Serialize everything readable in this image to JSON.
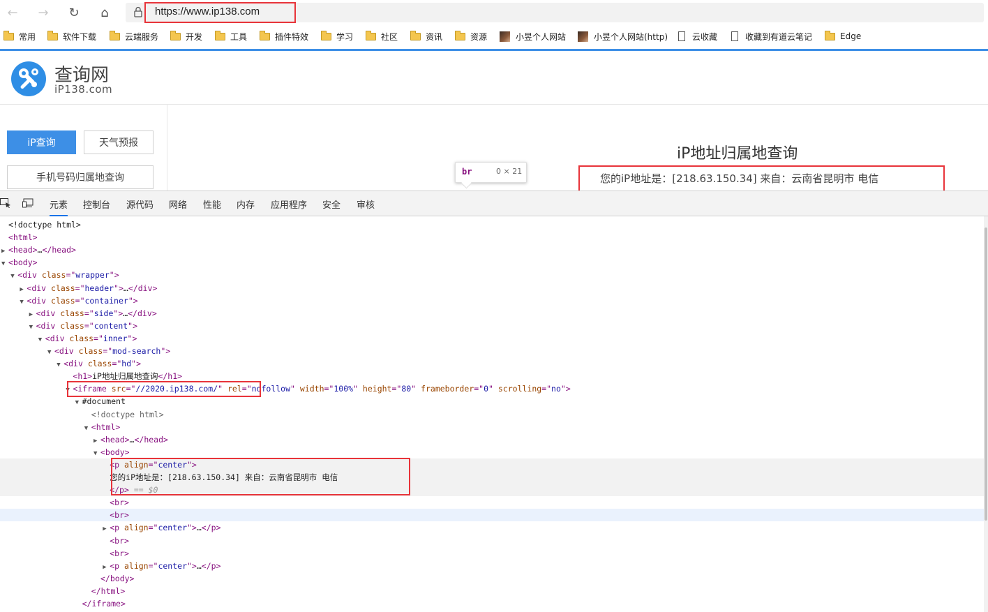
{
  "browser": {
    "url": "https://www.ip138.com",
    "bookmarks": [
      "常用",
      "软件下载",
      "云端服务",
      "开发",
      "工具",
      "插件特效",
      "学习",
      "社区",
      "资讯",
      "资源",
      "小昱个人网站",
      "小昱个人网站(http)",
      "云收藏",
      "收藏到有道云笔记",
      "Edge"
    ]
  },
  "site": {
    "logo_title": "查询网",
    "logo_sub": "iP138.com",
    "side": {
      "ip_btn": "iP查询",
      "weather_btn": "天气预报",
      "phone_btn": "手机号码归属地查询"
    },
    "h1": "iP地址归属地查询",
    "ip_line": "您的iP地址是：[218.63.150.34] 来自：云南省昆明市 电信"
  },
  "tooltip": {
    "tag": "br",
    "dims": "0 × 21"
  },
  "devtools": {
    "tabs": [
      "元素",
      "控制台",
      "源代码",
      "网络",
      "性能",
      "内存",
      "应用程序",
      "安全",
      "审核"
    ],
    "dom": [
      {
        "i": 0,
        "t": "",
        "h": "<span class='tx'>&lt;!doctype html&gt;</span>"
      },
      {
        "i": 0,
        "t": "",
        "h": "<span class='tg'>&lt;html&gt;</span>"
      },
      {
        "i": 0,
        "t": "▶",
        "h": "<span class='tg'>&lt;head&gt;</span><span class='tx'>…</span><span class='tg'>&lt;/head&gt;</span>"
      },
      {
        "i": 0,
        "t": "▼",
        "h": "<span class='tg'>&lt;body&gt;</span>"
      },
      {
        "i": 1,
        "t": "▼",
        "h": "<span class='tg'>&lt;div </span><span class='an'>class</span><span class='tg'>=\"</span><span class='av'>wrapper</span><span class='tg'>\"&gt;</span>"
      },
      {
        "i": 2,
        "t": "▶",
        "h": "<span class='tg'>&lt;div </span><span class='an'>class</span><span class='tg'>=\"</span><span class='av'>header</span><span class='tg'>\"&gt;</span><span class='tx'>…</span><span class='tg'>&lt;/div&gt;</span>"
      },
      {
        "i": 2,
        "t": "▼",
        "h": "<span class='tg'>&lt;div </span><span class='an'>class</span><span class='tg'>=\"</span><span class='av'>container</span><span class='tg'>\"&gt;</span>"
      },
      {
        "i": 3,
        "t": "▶",
        "h": "<span class='tg'>&lt;div </span><span class='an'>class</span><span class='tg'>=\"</span><span class='av'>side</span><span class='tg'>\"&gt;</span><span class='tx'>…</span><span class='tg'>&lt;/div&gt;</span>"
      },
      {
        "i": 3,
        "t": "▼",
        "h": "<span class='tg'>&lt;div </span><span class='an'>class</span><span class='tg'>=\"</span><span class='av'>content</span><span class='tg'>\"&gt;</span>"
      },
      {
        "i": 4,
        "t": "▼",
        "h": "<span class='tg'>&lt;div </span><span class='an'>class</span><span class='tg'>=\"</span><span class='av'>inner</span><span class='tg'>\"&gt;</span>"
      },
      {
        "i": 5,
        "t": "▼",
        "h": "<span class='tg'>&lt;div </span><span class='an'>class</span><span class='tg'>=\"</span><span class='av'>mod-search</span><span class='tg'>\"&gt;</span>"
      },
      {
        "i": 6,
        "t": "▼",
        "h": "<span class='tg'>&lt;div </span><span class='an'>class</span><span class='tg'>=\"</span><span class='av'>hd</span><span class='tg'>\"&gt;</span>"
      },
      {
        "i": 7,
        "t": "",
        "h": "<span class='tg'>&lt;h1&gt;</span><span class='tx'>iP地址归属地查询</span><span class='tg'>&lt;/h1&gt;</span>"
      },
      {
        "i": 7,
        "t": "▼",
        "h": "<span class='tg'>&lt;iframe </span><span class='an'>src</span><span class='tg'>=\"</span><span class='av'>//2020.ip138.com/</span><span class='tg'>\" </span><span class='an'>rel</span><span class='tg'>=\"</span><span class='av'>nofollow</span><span class='tg'>\" </span><span class='an'>width</span><span class='tg'>=\"</span><span class='av'>100%</span><span class='tg'>\" </span><span class='an'>height</span><span class='tg'>=\"</span><span class='av'>80</span><span class='tg'>\" </span><span class='an'>frameborder</span><span class='tg'>=\"</span><span class='av'>0</span><span class='tg'>\" </span><span class='an'>scrolling</span><span class='tg'>=\"</span><span class='av'>no</span><span class='tg'>\"&gt;</span>"
      },
      {
        "i": 8,
        "t": "▼",
        "h": "<span class='tx'>#document</span>"
      },
      {
        "i": 9,
        "t": "",
        "h": "<span class='tx' style='color:#666'>&lt;!doctype html&gt;</span>"
      },
      {
        "i": 9,
        "t": "▼",
        "h": "<span class='tg'>&lt;html&gt;</span>"
      },
      {
        "i": 10,
        "t": "▶",
        "h": "<span class='tg'>&lt;head&gt;</span><span class='tx'>…</span><span class='tg'>&lt;/head&gt;</span>"
      },
      {
        "i": 10,
        "t": "▼",
        "h": "<span class='tg'>&lt;body&gt;</span>"
      },
      {
        "i": 11,
        "t": "",
        "h": "<span class='tg'>&lt;p </span><span class='an'>align</span><span class='tg'>=\"</span><span class='av'>center</span><span class='tg'>\"&gt;</span>",
        "sel": true
      },
      {
        "i": 11,
        "t": "",
        "h": "<span class='tx'>您的iP地址是：[218.63.150.34] 来自：云南省昆明市 电信</span>",
        "sel": true
      },
      {
        "i": 11,
        "t": "",
        "h": "<span class='tg'>&lt;/p&gt;</span><span class='cm'> == $0</span>",
        "sel": true
      },
      {
        "i": 11,
        "t": "",
        "h": "<span class='tg'>&lt;br&gt;</span>"
      },
      {
        "i": 11,
        "t": "",
        "h": "<span class='tg'>&lt;br&gt;</span>",
        "hover": true
      },
      {
        "i": 11,
        "t": "▶",
        "h": "<span class='tg'>&lt;p </span><span class='an'>align</span><span class='tg'>=\"</span><span class='av'>center</span><span class='tg'>\"&gt;</span><span class='tx'>…</span><span class='tg'>&lt;/p&gt;</span>"
      },
      {
        "i": 11,
        "t": "",
        "h": "<span class='tg'>&lt;br&gt;</span>"
      },
      {
        "i": 11,
        "t": "",
        "h": "<span class='tg'>&lt;br&gt;</span>"
      },
      {
        "i": 11,
        "t": "▶",
        "h": "<span class='tg'>&lt;p </span><span class='an'>align</span><span class='tg'>=\"</span><span class='av'>center</span><span class='tg'>\"&gt;</span><span class='tx'>…</span><span class='tg'>&lt;/p&gt;</span>"
      },
      {
        "i": 10,
        "t": "",
        "h": "<span class='tg'>&lt;/body&gt;</span>"
      },
      {
        "i": 9,
        "t": "",
        "h": "<span class='tg'>&lt;/html&gt;</span>"
      },
      {
        "i": 8,
        "t": "",
        "h": "<span class='tg'>&lt;/iframe&gt;</span>"
      }
    ]
  }
}
